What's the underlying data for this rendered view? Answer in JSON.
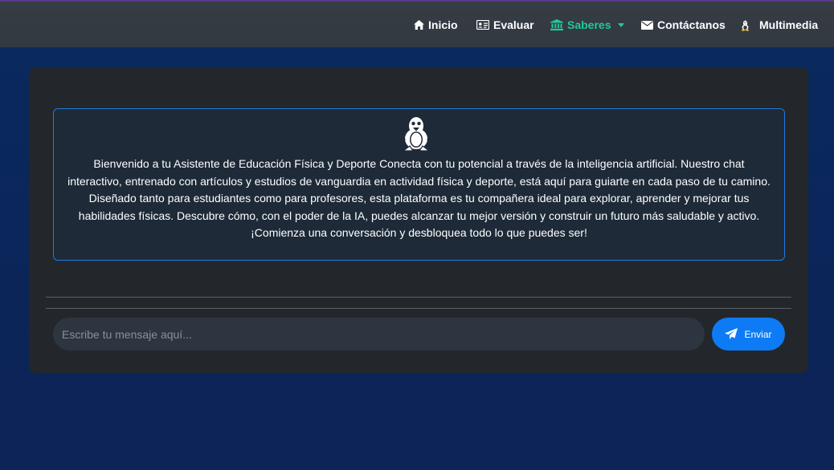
{
  "nav": {
    "items": [
      {
        "label": "Inicio",
        "icon": "home-icon"
      },
      {
        "label": "Evaluar",
        "icon": "id-card-icon"
      },
      {
        "label": "Saberes",
        "icon": "university-icon",
        "active": true,
        "dropdown": true
      },
      {
        "label": "Contáctanos",
        "icon": "envelope-icon"
      },
      {
        "label": "Multimedia",
        "icon": "linux-tux-icon"
      }
    ]
  },
  "chat": {
    "welcome_icon": "linux-tux-icon",
    "welcome_message": "Bienvenido a tu Asistente de Educación Física y Deporte Conecta con tu potencial a través de la inteligencia artificial. Nuestro chat interactivo, entrenado con artículos y estudios de vanguardia en actividad física y deporte, está aquí para guiarte en cada paso de tu camino. Diseñado tanto para estudiantes como para profesores, esta plataforma es tu compañera ideal para explorar, aprender y mejorar tus habilidades físicas. Descubre cómo, con el poder de la IA, puedes alcanzar tu mejor versión y construir un futuro más saludable y activo. ¡Comienza una conversación y desbloquea todo lo que puedes ser!",
    "input_placeholder": "Escribe tu mensaje aquí...",
    "input_value": "",
    "send_label": "Enviar",
    "send_icon": "paper-plane-icon"
  },
  "colors": {
    "accent": "#20c997",
    "primary": "#0d7bf5",
    "navbar_bg": "#343a40",
    "card_bg": "#23272b",
    "page_bg": "#0b2559",
    "welcome_border": "#1f7ae0"
  }
}
